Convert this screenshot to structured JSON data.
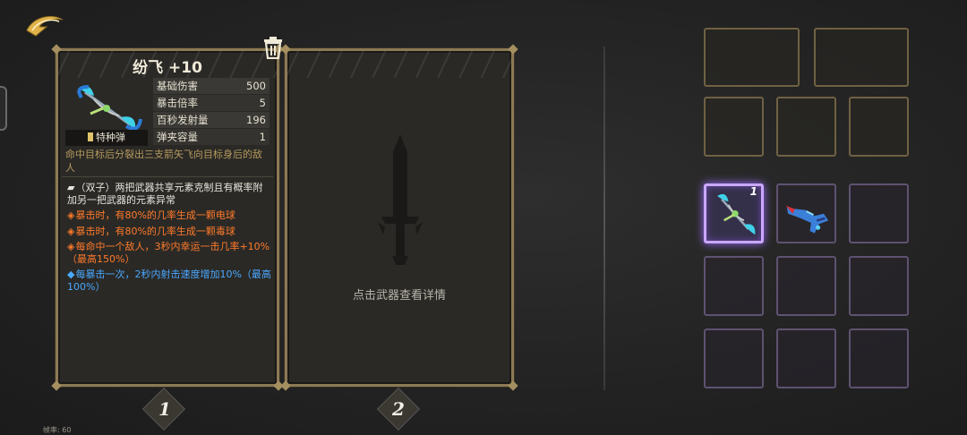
{
  "weapon": {
    "title": "纷飞 +10",
    "tag": "特种弹",
    "stats": [
      {
        "label": "基础伤害",
        "value": "500"
      },
      {
        "label": "暴击倍率",
        "value": "5"
      },
      {
        "label": "百秒发射量",
        "value": "196"
      },
      {
        "label": "弹夹容量",
        "value": "1"
      }
    ],
    "description": "命中目标后分裂出三支箭矢飞向目标身后的敌人",
    "effects": [
      {
        "bullet": "▰",
        "text": "（双子）两把武器共享元素克制且有概率附加另一把武器的元素异常",
        "color": "white"
      },
      {
        "bullet": "◈",
        "text": "暴击时，有80%的几率生成一颗电球",
        "color": "orange"
      },
      {
        "bullet": "◈",
        "text": "暴击时，有80%的几率生成一颗毒球",
        "color": "orange"
      },
      {
        "bullet": "◈",
        "text": "每命中一个敌人，3秒内幸运一击几率+10%（最高150%）",
        "color": "orange"
      },
      {
        "bullet": "◆",
        "text": "每暴击一次，2秒内射击速度增加10%（最高100%）",
        "color": "blue"
      }
    ]
  },
  "compare": {
    "hint": "点击武器查看详情"
  },
  "badges": {
    "one": "1",
    "two": "2"
  },
  "inventory": {
    "selected_count": "1"
  },
  "footer": {
    "fps": "帧率: 60"
  },
  "colors": {
    "gold_border": "#8c7a55",
    "purple_select": "#c9a7ff",
    "orange_effect": "#ff7a2a",
    "blue_effect": "#4aa8ff"
  }
}
